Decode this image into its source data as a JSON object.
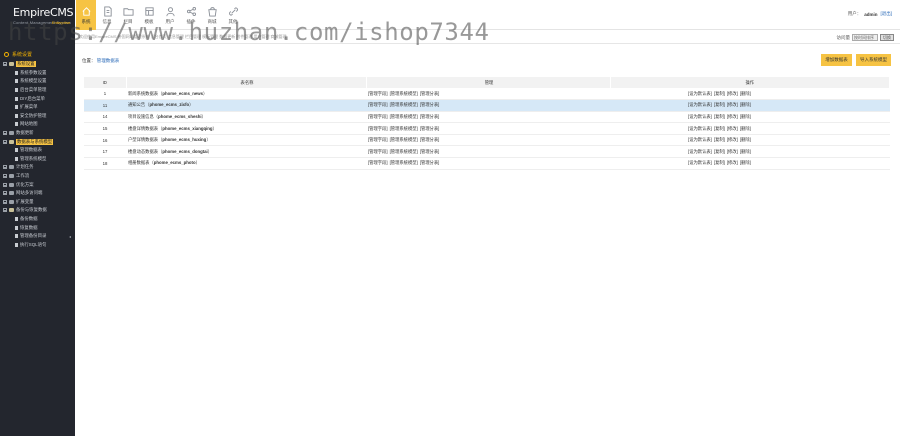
{
  "app": {
    "logo": "EmpireCMS",
    "logo_sub": "Content Management System",
    "logo_badge": "Enterprise"
  },
  "topnav": [
    {
      "label": "系统",
      "icon": "home-icon",
      "active": true
    },
    {
      "label": "信息",
      "icon": "document-icon",
      "active": false
    },
    {
      "label": "栏目",
      "icon": "folder-icon",
      "active": false
    },
    {
      "label": "模板",
      "icon": "template-icon",
      "active": false
    },
    {
      "label": "用户",
      "icon": "user-icon",
      "active": false
    },
    {
      "label": "插件",
      "icon": "share-icon",
      "active": false
    },
    {
      "label": "商城",
      "icon": "bag-icon",
      "active": false
    },
    {
      "label": "其他",
      "icon": "link-icon",
      "active": false
    }
  ],
  "user": {
    "prefix": "用户：",
    "name": "admin",
    "logout": "[退出]"
  },
  "strip_text": "欢迎使用EmpireCMS 帝国网站管理系统 后台首页 信息管理 栏目管理 模板管理 数据更新 附件管理 用户管理 商城管理",
  "watermark": "https://www.huzhan.com/ishop7344",
  "view_mode": {
    "label": "访问量",
    "select_value": "按时间排序",
    "button": "切换"
  },
  "sidebar": {
    "title": "系统设置",
    "rows": [
      {
        "level": 1,
        "icon": "folder-icon",
        "label": "系统设置",
        "hl": true,
        "open": true
      },
      {
        "level": 2,
        "icon": "doc-icon",
        "label": "系统参数设置"
      },
      {
        "level": 2,
        "icon": "doc-icon",
        "label": "系统模型设置"
      },
      {
        "level": 2,
        "icon": "doc-icon",
        "label": "后台菜单管理"
      },
      {
        "level": 2,
        "icon": "doc-icon",
        "label": "DIY后台菜单"
      },
      {
        "level": 2,
        "icon": "doc-icon",
        "label": "扩展菜单"
      },
      {
        "level": 2,
        "icon": "doc-icon",
        "label": "安全防护管理"
      },
      {
        "level": 2,
        "icon": "doc-icon",
        "label": "网站地图"
      },
      {
        "level": 1,
        "icon": "folder-icon",
        "label": "数据更新"
      },
      {
        "level": 1,
        "icon": "folder-icon",
        "label": "数据表与系统模型",
        "hl": true,
        "open": true
      },
      {
        "level": 2,
        "icon": "doc-icon",
        "label": "管理数据表"
      },
      {
        "level": 2,
        "icon": "doc-icon",
        "label": "管理系统模型"
      },
      {
        "level": 1,
        "icon": "folder-icon",
        "label": "计划任务"
      },
      {
        "level": 1,
        "icon": "folder-icon",
        "label": "工作流"
      },
      {
        "level": 1,
        "icon": "folder-icon",
        "label": "优化方案"
      },
      {
        "level": 1,
        "icon": "folder-icon",
        "label": "网站多访问端"
      },
      {
        "level": 1,
        "icon": "folder-icon",
        "label": "扩展变量"
      },
      {
        "level": 1,
        "icon": "folder-icon",
        "label": "备份与恢复数据",
        "open": true
      },
      {
        "level": 2,
        "icon": "doc-icon",
        "label": "备份数据"
      },
      {
        "level": 2,
        "icon": "doc-icon",
        "label": "恢复数据"
      },
      {
        "level": 2,
        "icon": "doc-icon",
        "label": "管理备份目录",
        "chevron": "◂"
      },
      {
        "level": 2,
        "icon": "doc-icon",
        "label": "执行SQL语句"
      }
    ]
  },
  "main": {
    "position_label": "位置：",
    "position_link": "管理数据表",
    "add_button": "增加数据表",
    "import_button": "导入系统模型",
    "table": {
      "headers": [
        "ID",
        "表名称",
        "管理",
        "操作"
      ],
      "rows": [
        {
          "id": "1",
          "name": "新闻系统数据表",
          "table": "phome_ecms_news",
          "mgr": [
            "[管理字段]",
            "[管理系统模型]",
            "[管理分表]"
          ],
          "ops": [
            "[设为默认表]",
            "[复制]",
            "[修改]",
            "[删除]"
          ]
        },
        {
          "id": "11",
          "name": "通知公告",
          "table": "phome_ecms_zixfo",
          "mgr": [
            "[管理字段]",
            "[管理系统模型]",
            "[管理分表]"
          ],
          "ops": [
            "[设为默认表]",
            "[复制]",
            "[修改]",
            "[删除]"
          ],
          "selected": true
        },
        {
          "id": "14",
          "name": "项目设施信息",
          "table": "phome_ecms_sheshi",
          "mgr": [
            "[管理字段]",
            "[管理系统模型]",
            "[管理分表]"
          ],
          "ops": [
            "[设为默认表]",
            "[复制]",
            "[修改]",
            "[删除]"
          ]
        },
        {
          "id": "15",
          "name": "楼盘详情数据表",
          "table": "phome_ecms_xiangqing",
          "mgr": [
            "[管理字段]",
            "[管理系统模型]",
            "[管理分表]"
          ],
          "ops": [
            "[设为默认表]",
            "[复制]",
            "[修改]",
            "[删除]"
          ]
        },
        {
          "id": "16",
          "name": "户型详情数据表",
          "table": "phome_ecms_huxing",
          "mgr": [
            "[管理字段]",
            "[管理系统模型]",
            "[管理分表]"
          ],
          "ops": [
            "[设为默认表]",
            "[复制]",
            "[修改]",
            "[删除]"
          ]
        },
        {
          "id": "17",
          "name": "楼盘动态数据表",
          "table": "phome_ecms_dongtai",
          "mgr": [
            "[管理字段]",
            "[管理系统模型]",
            "[管理分表]"
          ],
          "ops": [
            "[设为默认表]",
            "[复制]",
            "[修改]",
            "[删除]"
          ]
        },
        {
          "id": "18",
          "name": "相册数据表",
          "table": "phome_ecms_photo",
          "mgr": [
            "[管理字段]",
            "[管理系统模型]",
            "[管理分表]"
          ],
          "ops": [
            "[设为默认表]",
            "[复制]",
            "[修改]",
            "[删除]"
          ]
        }
      ]
    }
  },
  "colors": {
    "accent": "#f6c343",
    "sidebar_bg": "#23262e",
    "selected_row": "#d6e8f7"
  }
}
